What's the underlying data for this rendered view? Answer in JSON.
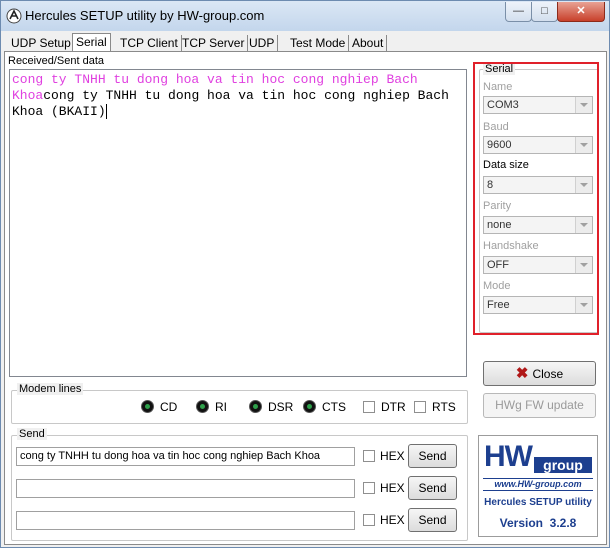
{
  "window": {
    "title": "Hercules SETUP utility by HW-group.com",
    "min_label": "—",
    "max_label": "□",
    "close_label": "✕"
  },
  "tabs": [
    {
      "label": "UDP Setup"
    },
    {
      "label": "Serial"
    },
    {
      "label": "TCP Client"
    },
    {
      "label": "TCP Server"
    },
    {
      "label": "UDP"
    },
    {
      "label": "Test Mode"
    },
    {
      "label": "About"
    }
  ],
  "received": {
    "label": "Received/Sent data",
    "sent_text": "cong ty TNHH tu dong hoa va tin hoc cong nghiep Bach Khoa",
    "received_text": "cong ty TNHH tu dong hoa va tin hoc cong nghiep Bach Khoa (BKAII)",
    "sent_color": "#e040e0"
  },
  "serial": {
    "group_label": "Serial",
    "highlight_color": "#e0202a",
    "fields": [
      {
        "label": "Name",
        "value": "COM3"
      },
      {
        "label": "Baud",
        "value": "9600"
      },
      {
        "label": "Data size",
        "value": "8"
      },
      {
        "label": "Parity",
        "value": "none"
      },
      {
        "label": "Handshake",
        "value": "OFF"
      },
      {
        "label": "Mode",
        "value": "Free"
      }
    ]
  },
  "buttons": {
    "close": "Close",
    "fw_update": "HWg FW update"
  },
  "modem": {
    "label": "Modem lines",
    "leds": [
      {
        "label": "CD"
      },
      {
        "label": "RI"
      },
      {
        "label": "DSR"
      },
      {
        "label": "CTS"
      }
    ],
    "checks": [
      {
        "label": "DTR"
      },
      {
        "label": "RTS"
      }
    ]
  },
  "send": {
    "label": "Send",
    "rows": [
      {
        "value": "cong ty TNHH tu dong hoa va tin hoc cong nghiep Bach Khoa",
        "hex_label": "HEX",
        "button": "Send"
      },
      {
        "value": "",
        "hex_label": "HEX",
        "button": "Send"
      },
      {
        "value": "",
        "hex_label": "HEX",
        "button": "Send"
      }
    ]
  },
  "logo": {
    "brand_hw": "HW",
    "brand_group": "group",
    "url": "www.HW-group.com",
    "product": "Hercules SETUP utility",
    "version": "Version  3.2.8",
    "brand_color": "#1d3f8f"
  }
}
